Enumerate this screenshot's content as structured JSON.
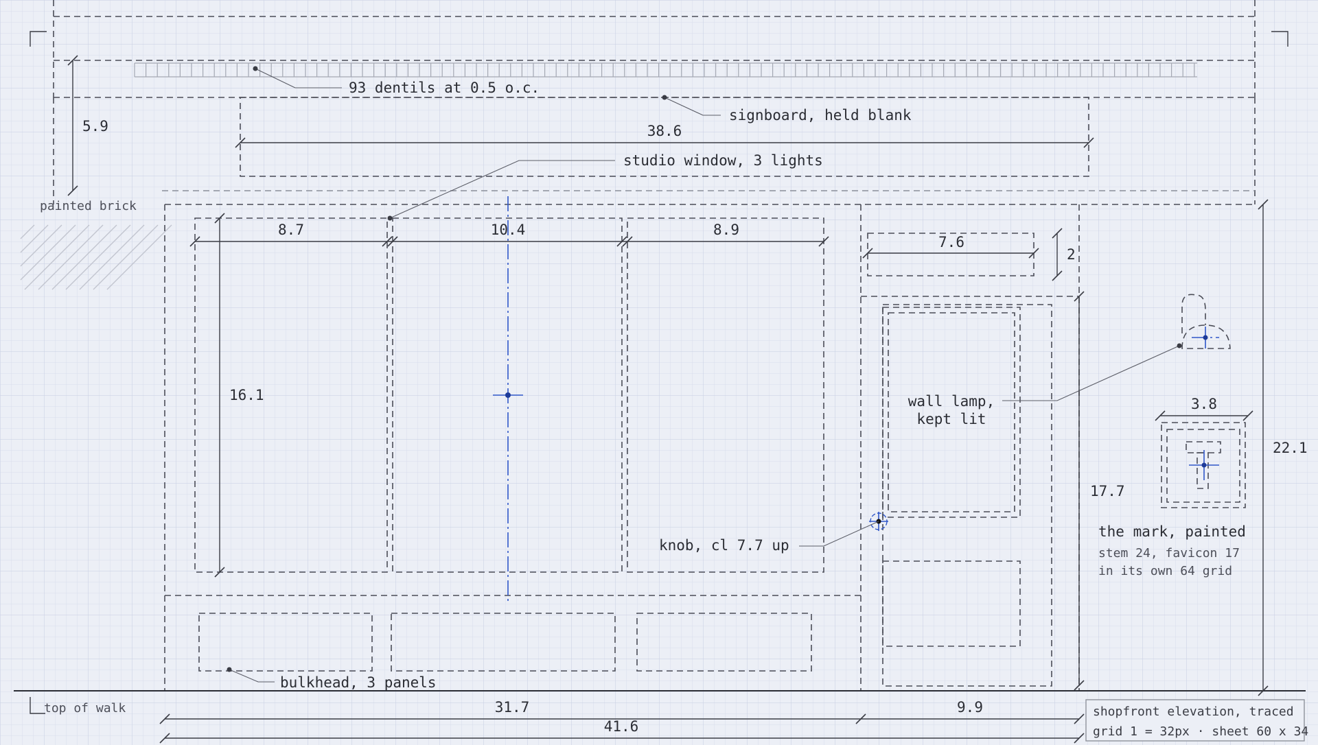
{
  "dimensions": {
    "cornice_height": "5.9",
    "signboard_width": "38.6",
    "window_light_1": "8.7",
    "window_light_2": "10.4",
    "window_light_3": "8.9",
    "window_height": "16.1",
    "transom_width": "7.6",
    "transom_height": "2",
    "mark_width": "3.8",
    "door_height": "17.7",
    "storefront_height": "22.1",
    "shop_width": "31.7",
    "door_bay_width": "9.9",
    "overall_width": "41.6"
  },
  "annotations": {
    "dentils": "93 dentils at 0.5 o.c.",
    "signboard": "signboard, held blank",
    "studio_window": "studio window, 3 lights",
    "painted_brick": "painted brick",
    "wall_lamp_line1": "wall lamp,",
    "wall_lamp_line2": "kept lit",
    "knob": "knob, cl 7.7 up",
    "bulkhead": "bulkhead, 3 panels",
    "mark_title": "the mark, painted",
    "mark_line1": "stem 24, favicon 17",
    "mark_line2": "in its own 64 grid",
    "top_of_walk": "top of walk"
  },
  "title_block": {
    "title": "shopfront elevation, traced",
    "scale": "grid 1 = 32px · sheet 60 x 34"
  },
  "colors": {
    "paper": "#eceff6",
    "grid_minor": "#d4dbeb",
    "grid_major": "#c3cbe0",
    "ink": "#3a3c44",
    "centerline": "#2f56c8"
  }
}
